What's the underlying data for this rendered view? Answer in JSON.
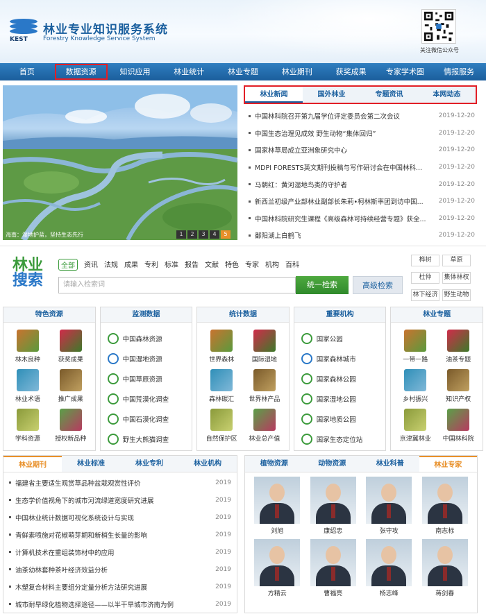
{
  "header": {
    "title": "林业专业知识服务系统",
    "subtitle": "Forestry Knowledge Service System",
    "logo_text": "KEST",
    "qr_label": "关注微信公众号"
  },
  "nav": {
    "items": [
      "首页",
      "数据资源",
      "知识应用",
      "林业统计",
      "林业专题",
      "林业期刊",
      "获奖成果",
      "专家学术圈",
      "情报服务"
    ],
    "highlighted": "数据资源"
  },
  "banner": {
    "caption": "海南：湿地护蓝，坚持生态先行",
    "pages": [
      "1",
      "2",
      "3",
      "4",
      "5"
    ],
    "active_page": "5"
  },
  "news": {
    "tabs": [
      "林业新闻",
      "国外林业",
      "专题资讯",
      "本网动态"
    ],
    "active_tab": "林业新闻",
    "items": [
      {
        "title": "中国林科院召开第九届学位评定委员会第二次会议",
        "date": "2019-12-20"
      },
      {
        "title": "中国生态治理见成效  野生动物“集体回归”",
        "date": "2019-12-20"
      },
      {
        "title": "国家林草局成立亚洲象研究中心",
        "date": "2019-12-20"
      },
      {
        "title": "MDPI FORESTS英文期刊投稿与写作研讨会在中国林科...",
        "date": "2019-12-20"
      },
      {
        "title": "马朝红：黄河湿地鸟类的守护者",
        "date": "2019-12-20"
      },
      {
        "title": "新西兰初级产业部林业副部长朱莉•柯林斯率团到访中国...",
        "date": "2019-12-20"
      },
      {
        "title": "中国林科院研究生课程《高级森林可持续经营专题》获全...",
        "date": "2019-12-20"
      },
      {
        "title": "鄱阳湖上白鹤飞",
        "date": "2019-12-20"
      }
    ]
  },
  "search": {
    "logo_line1": "林业",
    "logo_line2": "搜索",
    "tags": [
      "全部",
      "资讯",
      "法规",
      "成果",
      "专利",
      "标准",
      "报告",
      "文献",
      "特色",
      "专家",
      "机构",
      "百科"
    ],
    "active_tag": "全部",
    "placeholder": "请输入检索词",
    "search_btn": "统一检索",
    "advanced_btn": "高级检索",
    "hot": [
      "桦树",
      "草原",
      "杜仲",
      "集体林权",
      "林下经济",
      "野生动物"
    ]
  },
  "cards": {
    "featured": {
      "title": "特色资源",
      "items": [
        "林木良种",
        "获奖成果",
        "林业术语",
        "推广成果",
        "学科资源",
        "授权新品种"
      ]
    },
    "monitoring": {
      "title": "监测数据",
      "items": [
        "中国森林资源",
        "中国湿地资源",
        "中国草原资源",
        "中国荒漠化调查",
        "中国石漠化调查",
        "野生大熊猫调查"
      ]
    },
    "statistics": {
      "title": "统计数据",
      "items": [
        "世界森林",
        "国际湿地",
        "森林碳汇",
        "世界林产品",
        "自然保护区",
        "林业总产值"
      ]
    },
    "institutions": {
      "title": "重要机构",
      "items": [
        "国家公园",
        "国家森林城市",
        "国家森林公园",
        "国家湿地公园",
        "国家地质公园",
        "国家生态定位站"
      ]
    },
    "topics": {
      "title": "林业专题",
      "items": [
        "一带一路",
        "油茶专题",
        "乡村振兴",
        "知识产权",
        "京津冀林业",
        "中国林科院"
      ]
    }
  },
  "journals": {
    "tabs": [
      "林业期刊",
      "林业标准",
      "林业专利",
      "林业机构"
    ],
    "active_tab": "林业期刊",
    "items": [
      {
        "title": "福建省主要适生观赏草品种盆栽观赏性评价",
        "year": "2019"
      },
      {
        "title": "生态学价值视角下的城市河流绿道宽度研究进展",
        "year": "2019"
      },
      {
        "title": "中国林业统计数据可视化系统设计与实现",
        "year": "2019"
      },
      {
        "title": "青鲜素喷施对花椒萌芽期和新梢生长量的影响",
        "year": "2019"
      },
      {
        "title": "计算机技术在重组装饰材中的应用",
        "year": "2019"
      },
      {
        "title": "油茶幼林套种茶叶经济效益分析",
        "year": "2019"
      },
      {
        "title": "木塑复合材料主要组分定量分析方法研究进展",
        "year": "2019"
      },
      {
        "title": "城市耐旱绿化植物选择途径——以半干旱城市济南为例",
        "year": "2019"
      }
    ]
  },
  "resources": {
    "tabs": [
      "植物资源",
      "动物资源",
      "林业科普",
      "林业专家"
    ],
    "active_tab": "林业专家",
    "experts": [
      "刘旭",
      "康绍忠",
      "张守攻",
      "南志标",
      "方精云",
      "曹福亮",
      "杨志峰",
      "蒋剑春"
    ]
  },
  "colors": {
    "brand": "#1a5f9e",
    "nav": "#2f7ec0",
    "green": "#3c9b3c",
    "accent": "#e8902a",
    "highlight": "#e21f26"
  }
}
